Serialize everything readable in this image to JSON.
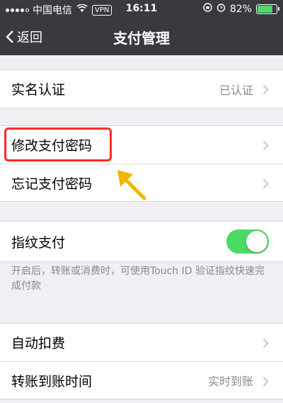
{
  "status_bar": {
    "carrier": "中国电信",
    "vpn": "VPN",
    "time": "16:11",
    "battery": "82%",
    "battery_level": 0.82
  },
  "nav": {
    "back_label": "返回",
    "title": "支付管理"
  },
  "sections": {
    "verify": {
      "label": "实名认证",
      "detail": "已认证"
    },
    "modify_password": {
      "label": "修改支付密码"
    },
    "forgot_password": {
      "label": "忘记支付密码"
    },
    "fingerprint": {
      "label": "指纹支付",
      "enabled": true,
      "hint": "开启后，转账或消费时，可使用Touch ID 验证指纹快速完成付款"
    },
    "auto_deduct": {
      "label": "自动扣费"
    },
    "transfer_time": {
      "label": "转账到账时间",
      "detail": "实时到账"
    }
  },
  "colors": {
    "nav_bg": "#393a3f",
    "toggle_on": "#4cd964",
    "highlight": "#ff2a2a",
    "arrow": "#f5b400"
  }
}
